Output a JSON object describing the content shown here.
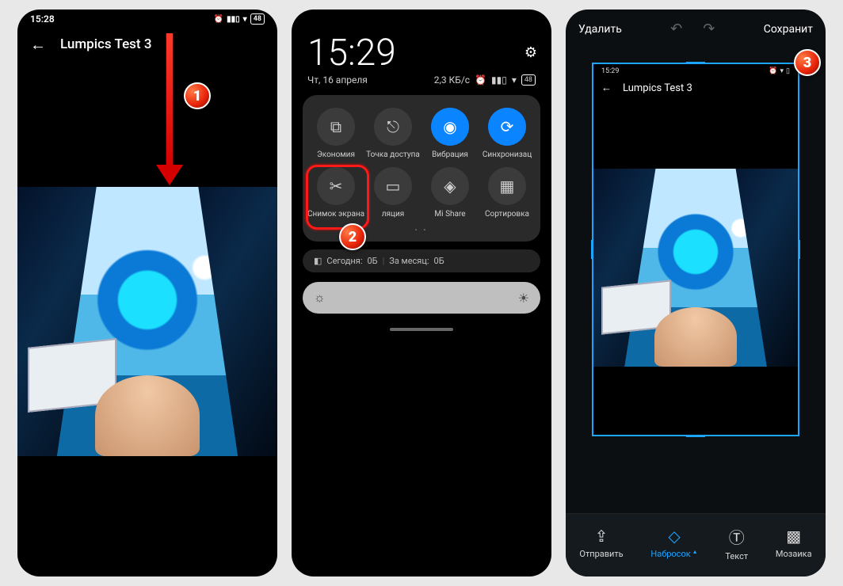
{
  "screen1": {
    "status_time": "15:28",
    "battery": "48",
    "title": "Lumpics Test 3",
    "badge": "1"
  },
  "screen2": {
    "big_time": "15:29",
    "date": "Чт, 16 апреля",
    "net_speed": "2,3 КБ/с",
    "battery": "48",
    "badge": "2",
    "tiles_row1": [
      {
        "label": "Экономия",
        "on": false
      },
      {
        "label": "Точка доступа",
        "on": false
      },
      {
        "label": "Вибрация",
        "on": true
      },
      {
        "label": "Синхронизац",
        "on": true
      }
    ],
    "tiles_row2": [
      {
        "label": "Снимок экрана",
        "on": false
      },
      {
        "label": "ляция",
        "on": false
      },
      {
        "label": "Mi Share",
        "on": false
      },
      {
        "label": "Сортировка",
        "on": false
      }
    ],
    "usage_today_label": "Сегодня:",
    "usage_today": "0Б",
    "usage_month_label": "За месяц:",
    "usage_month": "0Б"
  },
  "screen3": {
    "delete": "Удалить",
    "save": "Сохранит",
    "badge": "3",
    "inner_time": "15:29",
    "inner_title": "Lumpics Test 3",
    "tools": [
      {
        "label": "Отправить"
      },
      {
        "label": "Набросок"
      },
      {
        "label": "Текст"
      },
      {
        "label": "Мозаика"
      }
    ]
  }
}
